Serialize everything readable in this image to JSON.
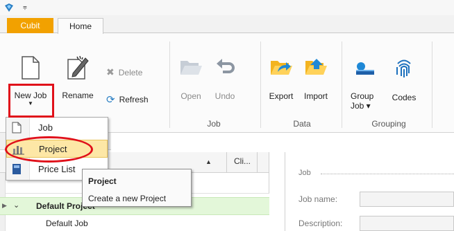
{
  "tabs": {
    "cubit": "Cubit",
    "home": "Home"
  },
  "ribbon": {
    "new_job": "New Job",
    "rename": "Rename",
    "delete": "Delete",
    "refresh": "Refresh",
    "open": "Open",
    "undo": "Undo",
    "export": "Export",
    "import": "Import",
    "group_job_line1": "Group",
    "group_job_line2": "Job ▾",
    "codes": "Codes",
    "groups": {
      "job": "Job",
      "data": "Data",
      "grouping": "Grouping"
    }
  },
  "dropdown": {
    "items": [
      {
        "label": "Job",
        "icon": "document-icon"
      },
      {
        "label": "Project",
        "icon": "project-icon"
      },
      {
        "label": "Price List",
        "icon": "price-list-icon"
      }
    ]
  },
  "tooltip": {
    "title": "Project",
    "description": "Create a new Project"
  },
  "grid": {
    "column_cli": "Cli...",
    "rows": [
      {
        "label": "Default Project"
      },
      {
        "label": "Default Job"
      }
    ]
  },
  "form": {
    "legend": "Job",
    "fields": [
      {
        "label": "Job name:"
      },
      {
        "label": "Description:"
      }
    ]
  },
  "colors": {
    "cubit_tab": "#f2a100",
    "highlight_red": "#e0101a",
    "project_row": "#e3f7d9",
    "menu_hover": "#fde7a6"
  }
}
